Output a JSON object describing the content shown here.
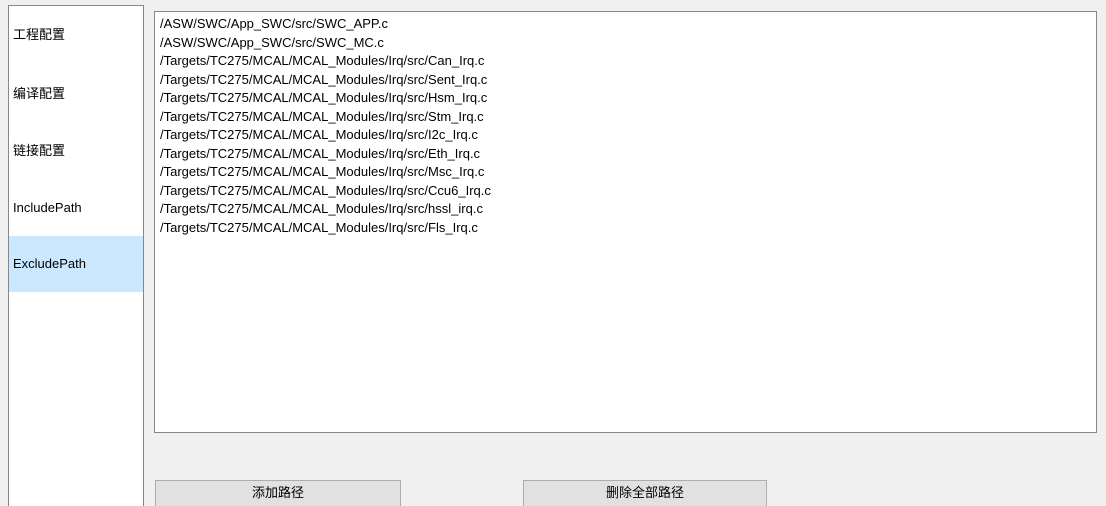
{
  "sidebar": {
    "items": [
      {
        "label": "工程配置",
        "selected": false
      },
      {
        "label": "编译配置",
        "selected": false
      },
      {
        "label": "链接配置",
        "selected": false
      },
      {
        "label": "IncludePath",
        "selected": false
      },
      {
        "label": "ExcludePath",
        "selected": true
      }
    ]
  },
  "paths": [
    "/ASW/SWC/App_SWC/src/SWC_APP.c",
    "/ASW/SWC/App_SWC/src/SWC_MC.c",
    "/Targets/TC275/MCAL/MCAL_Modules/Irq/src/Can_Irq.c",
    "/Targets/TC275/MCAL/MCAL_Modules/Irq/src/Sent_Irq.c",
    "/Targets/TC275/MCAL/MCAL_Modules/Irq/src/Hsm_Irq.c",
    "/Targets/TC275/MCAL/MCAL_Modules/Irq/src/Stm_Irq.c",
    "/Targets/TC275/MCAL/MCAL_Modules/Irq/src/I2c_Irq.c",
    "/Targets/TC275/MCAL/MCAL_Modules/Irq/src/Eth_Irq.c",
    "/Targets/TC275/MCAL/MCAL_Modules/Irq/src/Msc_Irq.c",
    "/Targets/TC275/MCAL/MCAL_Modules/Irq/src/Ccu6_Irq.c",
    "/Targets/TC275/MCAL/MCAL_Modules/Irq/src/hssl_irq.c",
    "/Targets/TC275/MCAL/MCAL_Modules/Irq/src/Fls_Irq.c"
  ],
  "buttons": {
    "add_label": "添加路径",
    "delete_all_label": "删除全部路径"
  },
  "colors": {
    "selected_bg": "#cce8ff",
    "window_bg": "#f0f0f0",
    "border": "#828790",
    "button_bg": "#e1e1e1"
  }
}
